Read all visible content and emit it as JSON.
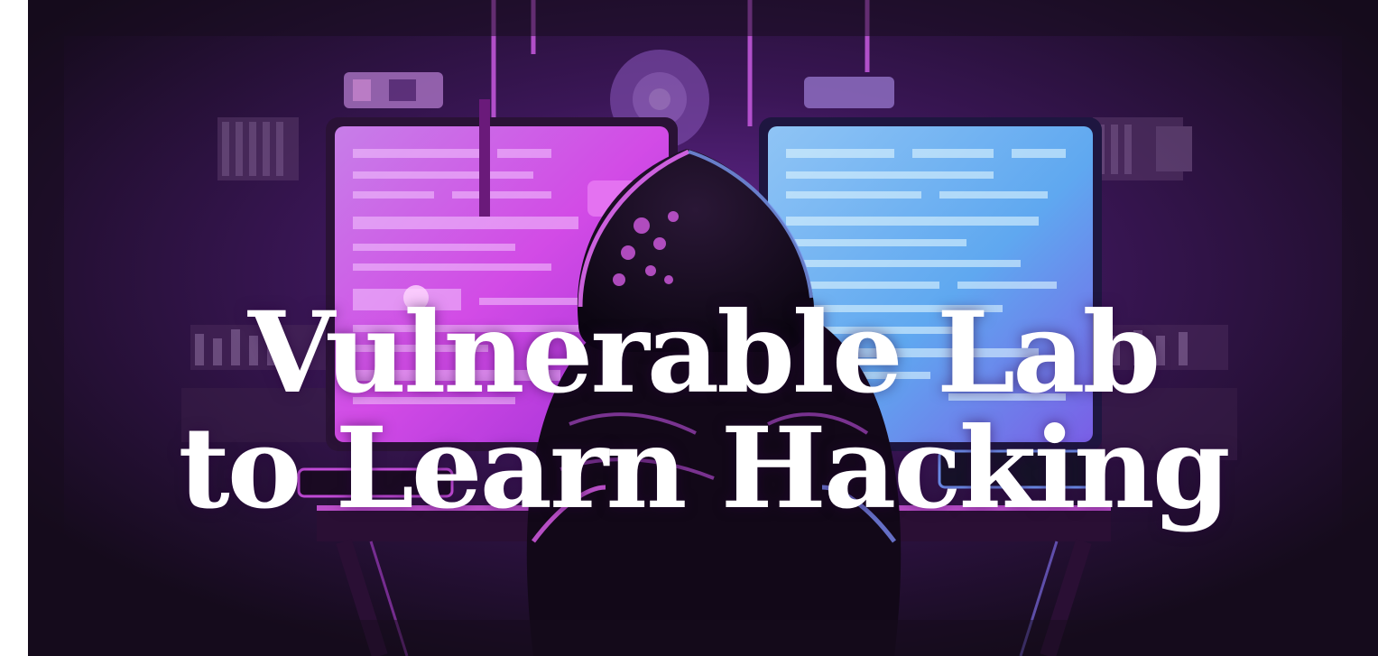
{
  "banner": {
    "title_line_1": "Vulnerable Lab",
    "title_line_2": "to Learn Hacking"
  },
  "illustration": {
    "subject": "hooded-figure-icon",
    "left_monitor": "monitor-icon",
    "right_monitor": "monitor-icon"
  },
  "colors": {
    "background": "#150b1c",
    "left_screen": "#d24be6",
    "right_screen": "#5fa8f0",
    "glow": "#8a2be2",
    "title": "#ffffff"
  }
}
